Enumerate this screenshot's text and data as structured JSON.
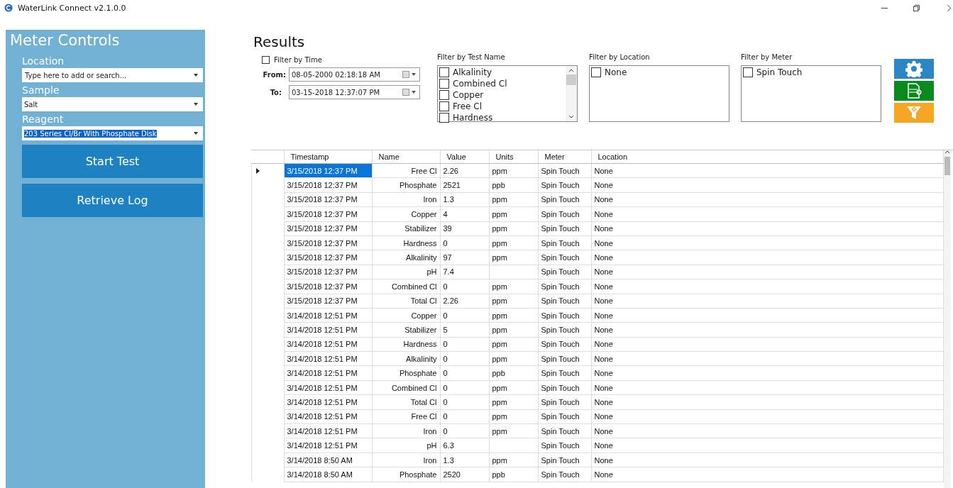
{
  "window": {
    "title": "WaterLink Connect v2.1.0.0"
  },
  "sidebar": {
    "title": "Meter Controls",
    "fields": [
      {
        "label": "Location",
        "placeholder": "Type here to add or search..."
      },
      {
        "label": "Sample",
        "value": "Salt",
        "selected": false
      },
      {
        "label": "Reagent",
        "value": "203 Series Cl/Br With Phosphate Disk",
        "selected": true
      }
    ],
    "buttons": [
      "Start Test",
      "Retrieve Log"
    ]
  },
  "results": {
    "title": "Results",
    "time_filter": {
      "label": "Filter by Time",
      "checked": false,
      "from_label": "From:",
      "from": "08-05-2000 02:18:18 AM",
      "to_label": "To:",
      "to": "03-15-2018 12:37:07 PM"
    },
    "filters": [
      {
        "label": "Filter by Test Name",
        "scrollable": true,
        "items": [
          {
            "label": "Alkalinity",
            "checked": false
          },
          {
            "label": "Combined Cl",
            "checked": false
          },
          {
            "label": "Copper",
            "checked": false
          },
          {
            "label": "Free Cl",
            "checked": false
          },
          {
            "label": "Hardness",
            "checked": false
          }
        ]
      },
      {
        "label": "Filter by Location",
        "scrollable": false,
        "items": [
          {
            "label": "None",
            "checked": false
          }
        ]
      },
      {
        "label": "Filter by Meter",
        "scrollable": false,
        "items": [
          {
            "label": "Spin Touch",
            "checked": false
          }
        ]
      }
    ],
    "actions": [
      {
        "kind": "settings"
      },
      {
        "kind": "export"
      },
      {
        "kind": "clear-filter"
      }
    ]
  },
  "table": {
    "columns": [
      "Timestamp",
      "Name",
      "Value",
      "Units",
      "Meter",
      "Location"
    ],
    "rows": [
      {
        "selected": true,
        "timestamp": "3/15/2018 12:37 PM",
        "name": "Free Cl",
        "value": "2.26",
        "units": "ppm",
        "meter": "Spin Touch",
        "location": "None"
      },
      {
        "selected": false,
        "timestamp": "3/15/2018 12:37 PM",
        "name": "Phosphate",
        "value": "2521",
        "units": "ppb",
        "meter": "Spin Touch",
        "location": "None"
      },
      {
        "selected": false,
        "timestamp": "3/15/2018 12:37 PM",
        "name": "Iron",
        "value": "1.3",
        "units": "ppm",
        "meter": "Spin Touch",
        "location": "None"
      },
      {
        "selected": false,
        "timestamp": "3/15/2018 12:37 PM",
        "name": "Copper",
        "value": "4",
        "units": "ppm",
        "meter": "Spin Touch",
        "location": "None"
      },
      {
        "selected": false,
        "timestamp": "3/15/2018 12:37 PM",
        "name": "Stabilizer",
        "value": "39",
        "units": "ppm",
        "meter": "Spin Touch",
        "location": "None"
      },
      {
        "selected": false,
        "timestamp": "3/15/2018 12:37 PM",
        "name": "Hardness",
        "value": "0",
        "units": "ppm",
        "meter": "Spin Touch",
        "location": "None"
      },
      {
        "selected": false,
        "timestamp": "3/15/2018 12:37 PM",
        "name": "Alkalinity",
        "value": "97",
        "units": "ppm",
        "meter": "Spin Touch",
        "location": "None"
      },
      {
        "selected": false,
        "timestamp": "3/15/2018 12:37 PM",
        "name": "pH",
        "value": "7.4",
        "meter": "Spin Touch",
        "location": "None"
      },
      {
        "selected": false,
        "timestamp": "3/15/2018 12:37 PM",
        "name": "Combined Cl",
        "value": "0",
        "units": "ppm",
        "meter": "Spin Touch",
        "location": "None"
      },
      {
        "selected": false,
        "timestamp": "3/15/2018 12:37 PM",
        "name": "Total Cl",
        "value": "2.26",
        "units": "ppm",
        "meter": "Spin Touch",
        "location": "None"
      },
      {
        "selected": false,
        "timestamp": "3/14/2018 12:51 PM",
        "name": "Copper",
        "value": "0",
        "units": "ppm",
        "meter": "Spin Touch",
        "location": "None"
      },
      {
        "selected": false,
        "timestamp": "3/14/2018 12:51 PM",
        "name": "Stabilizer",
        "value": "5",
        "units": "ppm",
        "meter": "Spin Touch",
        "location": "None"
      },
      {
        "selected": false,
        "timestamp": "3/14/2018 12:51 PM",
        "name": "Hardness",
        "value": "0",
        "units": "ppm",
        "meter": "Spin Touch",
        "location": "None"
      },
      {
        "selected": false,
        "timestamp": "3/14/2018 12:51 PM",
        "name": "Alkalinity",
        "value": "0",
        "units": "ppm",
        "meter": "Spin Touch",
        "location": "None"
      },
      {
        "selected": false,
        "timestamp": "3/14/2018 12:51 PM",
        "name": "Phosphate",
        "value": "0",
        "units": "ppb",
        "meter": "Spin Touch",
        "location": "None"
      },
      {
        "selected": false,
        "timestamp": "3/14/2018 12:51 PM",
        "name": "Combined Cl",
        "value": "0",
        "units": "ppm",
        "meter": "Spin Touch",
        "location": "None"
      },
      {
        "selected": false,
        "timestamp": "3/14/2018 12:51 PM",
        "name": "Total Cl",
        "value": "0",
        "units": "ppm",
        "meter": "Spin Touch",
        "location": "None"
      },
      {
        "selected": false,
        "timestamp": "3/14/2018 12:51 PM",
        "name": "Free Cl",
        "value": "0",
        "units": "ppm",
        "meter": "Spin Touch",
        "location": "None"
      },
      {
        "selected": false,
        "timestamp": "3/14/2018 12:51 PM",
        "name": "Iron",
        "value": "0",
        "units": "ppm",
        "meter": "Spin Touch",
        "location": "None"
      },
      {
        "selected": false,
        "timestamp": "3/14/2018 12:51 PM",
        "name": "pH",
        "value": "6.3",
        "meter": "Spin Touch",
        "location": "None"
      },
      {
        "selected": false,
        "timestamp": "3/14/2018 8:50 AM",
        "name": "Iron",
        "value": "1.3",
        "units": "ppm",
        "meter": "Spin Touch",
        "location": "None"
      },
      {
        "selected": false,
        "timestamp": "3/14/2018 8:50 AM",
        "name": "Phosphate",
        "value": "2520",
        "units": "ppb",
        "meter": "Spin Touch",
        "location": "None"
      }
    ]
  }
}
